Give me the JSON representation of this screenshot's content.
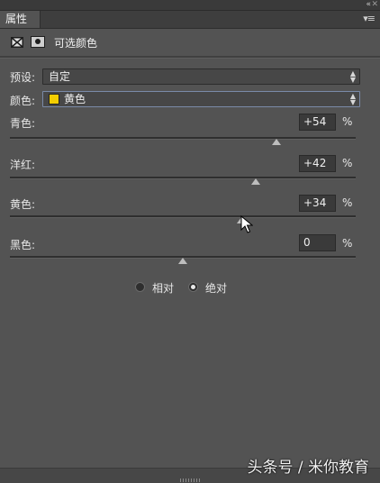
{
  "panel": {
    "tab_label": "属性",
    "collapse_icon": "«",
    "menu_icon": "≡"
  },
  "header": {
    "adj_icon": "selective-color-adjustment-icon",
    "mask_icon": "layer-mask-icon",
    "title": "可选颜色"
  },
  "preset": {
    "label": "预设:",
    "value": "自定"
  },
  "colors": {
    "label": "颜色:",
    "value": "黄色",
    "swatch_color": "#f2cd00"
  },
  "sliders": [
    {
      "label": "青色:",
      "value": "+54",
      "unit": "%",
      "percent": 54
    },
    {
      "label": "洋红:",
      "value": "+42",
      "unit": "%",
      "percent": 42
    },
    {
      "label": "黄色:",
      "value": "+34",
      "unit": "%",
      "percent": 34
    },
    {
      "label": "黑色:",
      "value": "0",
      "unit": "%",
      "percent": 0
    }
  ],
  "method": {
    "relative_label": "相对",
    "absolute_label": "绝对",
    "selected": "absolute"
  },
  "watermark": "头条号 / 米你教育"
}
